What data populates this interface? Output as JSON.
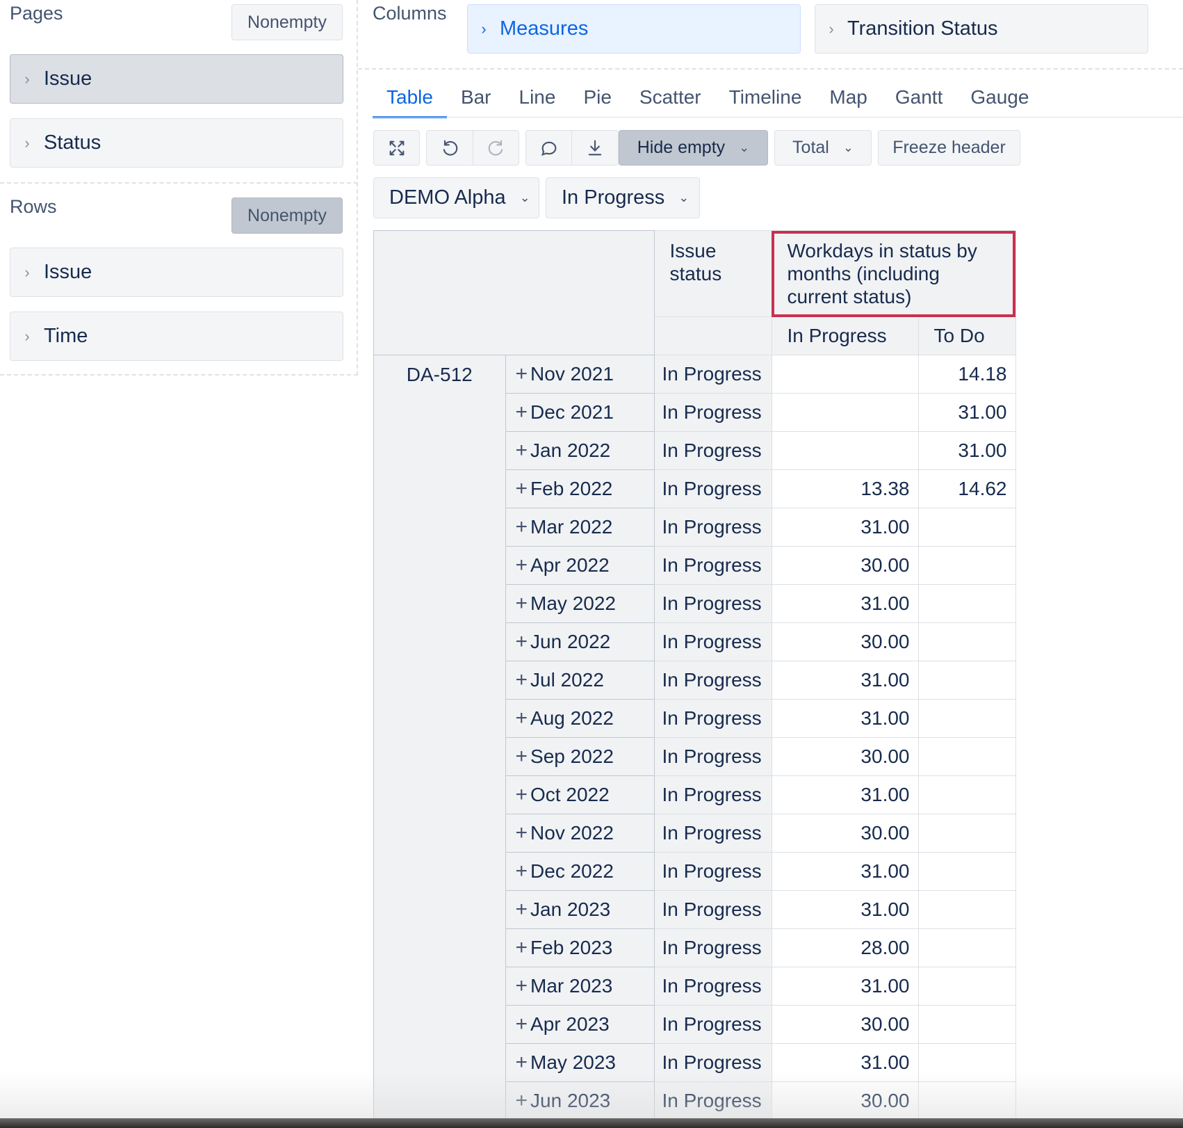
{
  "pages": {
    "title": "Pages",
    "nonempty_label": "Nonempty",
    "items": [
      {
        "label": "Issue"
      },
      {
        "label": "Status"
      }
    ]
  },
  "rows": {
    "title": "Rows",
    "nonempty_label": "Nonempty",
    "items": [
      {
        "label": "Issue"
      },
      {
        "label": "Time"
      }
    ]
  },
  "columns": {
    "title": "Columns",
    "items": [
      {
        "label": "Measures"
      },
      {
        "label": "Transition Status"
      }
    ]
  },
  "tabs": [
    "Table",
    "Bar",
    "Line",
    "Pie",
    "Scatter",
    "Timeline",
    "Map",
    "Gantt",
    "Gauge"
  ],
  "active_tab": "Table",
  "toolbar": {
    "hide_empty_label": "Hide empty",
    "total_label": "Total",
    "freeze_header_label": "Freeze header"
  },
  "filters": {
    "project": "DEMO Alpha",
    "status": "In Progress"
  },
  "table": {
    "header_issue_status": "Issue status",
    "header_measure": "Workdays in status by months (including current status)",
    "sub_headers": [
      "In Progress",
      "To Do"
    ],
    "issue": "DA-512",
    "rows": [
      {
        "month": "Nov 2021",
        "status": "In Progress",
        "in_progress": "",
        "to_do": "14.18"
      },
      {
        "month": "Dec 2021",
        "status": "In Progress",
        "in_progress": "",
        "to_do": "31.00"
      },
      {
        "month": "Jan 2022",
        "status": "In Progress",
        "in_progress": "",
        "to_do": "31.00"
      },
      {
        "month": "Feb 2022",
        "status": "In Progress",
        "in_progress": "13.38",
        "to_do": "14.62"
      },
      {
        "month": "Mar 2022",
        "status": "In Progress",
        "in_progress": "31.00",
        "to_do": ""
      },
      {
        "month": "Apr 2022",
        "status": "In Progress",
        "in_progress": "30.00",
        "to_do": ""
      },
      {
        "month": "May 2022",
        "status": "In Progress",
        "in_progress": "31.00",
        "to_do": ""
      },
      {
        "month": "Jun 2022",
        "status": "In Progress",
        "in_progress": "30.00",
        "to_do": ""
      },
      {
        "month": "Jul 2022",
        "status": "In Progress",
        "in_progress": "31.00",
        "to_do": ""
      },
      {
        "month": "Aug 2022",
        "status": "In Progress",
        "in_progress": "31.00",
        "to_do": ""
      },
      {
        "month": "Sep 2022",
        "status": "In Progress",
        "in_progress": "30.00",
        "to_do": ""
      },
      {
        "month": "Oct 2022",
        "status": "In Progress",
        "in_progress": "31.00",
        "to_do": ""
      },
      {
        "month": "Nov 2022",
        "status": "In Progress",
        "in_progress": "30.00",
        "to_do": ""
      },
      {
        "month": "Dec 2022",
        "status": "In Progress",
        "in_progress": "31.00",
        "to_do": ""
      },
      {
        "month": "Jan 2023",
        "status": "In Progress",
        "in_progress": "31.00",
        "to_do": ""
      },
      {
        "month": "Feb 2023",
        "status": "In Progress",
        "in_progress": "28.00",
        "to_do": ""
      },
      {
        "month": "Mar 2023",
        "status": "In Progress",
        "in_progress": "31.00",
        "to_do": ""
      },
      {
        "month": "Apr 2023",
        "status": "In Progress",
        "in_progress": "30.00",
        "to_do": ""
      },
      {
        "month": "May 2023",
        "status": "In Progress",
        "in_progress": "31.00",
        "to_do": ""
      },
      {
        "month": "Jun 2023",
        "status": "In Progress",
        "in_progress": "30.00",
        "to_do": ""
      }
    ]
  },
  "colors": {
    "accent": "#0c66e4",
    "highlight_border": "#c9304f"
  }
}
